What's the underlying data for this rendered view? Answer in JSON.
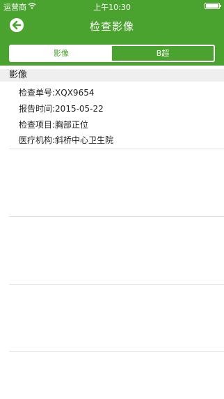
{
  "status_bar": {
    "carrier": "运营商",
    "time": "上午10:30"
  },
  "nav": {
    "title": "检查影像",
    "back_icon": "back-arrow-circle-icon"
  },
  "segments": [
    "影像",
    "B超"
  ],
  "selected_segment": "影像",
  "section": {
    "title": "影像"
  },
  "details": [
    "检查单号:XQX9654",
    "报告时间:2015-05-22",
    "检查项目:胸部正位",
    "医疗机构:斜桥中心卫生院"
  ],
  "colors": {
    "primary": "#4aa32e",
    "section_bg": "#efefef"
  }
}
